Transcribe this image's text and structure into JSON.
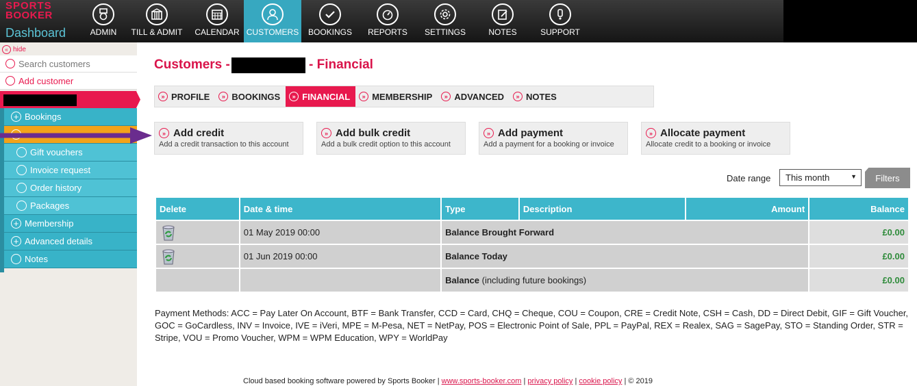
{
  "brand": {
    "line1": "SPORTS",
    "line2": "BOOKER",
    "line3": "Dashboard"
  },
  "nav": [
    {
      "label": "ADMIN",
      "icon": "admin-medal-icon"
    },
    {
      "label": "TILL & ADMIT",
      "icon": "till-gate-icon"
    },
    {
      "label": "CALENDAR",
      "icon": "calendar-icon"
    },
    {
      "label": "CUSTOMERS",
      "icon": "user-icon",
      "active": true
    },
    {
      "label": "BOOKINGS",
      "icon": "check-icon"
    },
    {
      "label": "REPORTS",
      "icon": "gauge-icon"
    },
    {
      "label": "SETTINGS",
      "icon": "gear-icon"
    },
    {
      "label": "NOTES",
      "icon": "edit-note-icon"
    },
    {
      "label": "SUPPORT",
      "icon": "exclamation-icon"
    }
  ],
  "sidebar": {
    "hide": "hide",
    "search": "Search customers",
    "add": "Add customer",
    "items": [
      {
        "label": "Bookings",
        "type": "top",
        "icon": "plus"
      },
      {
        "label": "",
        "type": "top",
        "icon": "minus"
      },
      {
        "label": "Gift vouchers",
        "type": "sub"
      },
      {
        "label": "Invoice request",
        "type": "sub"
      },
      {
        "label": "Order history",
        "type": "sub"
      },
      {
        "label": "Packages",
        "type": "sub"
      },
      {
        "label": "Membership",
        "type": "top",
        "icon": "plus"
      },
      {
        "label": "Advanced details",
        "type": "top",
        "icon": "plus"
      },
      {
        "label": "Notes",
        "type": "top",
        "icon": "circle"
      }
    ]
  },
  "page": {
    "title_prefix": "Customers -",
    "title_suffix": "- Financial"
  },
  "tabs": [
    {
      "label": "PROFILE"
    },
    {
      "label": "BOOKINGS"
    },
    {
      "label": "FINANCIAL",
      "active": true
    },
    {
      "label": "MEMBERSHIP"
    },
    {
      "label": "ADVANCED"
    },
    {
      "label": "NOTES"
    }
  ],
  "actions": [
    {
      "title": "Add credit",
      "desc": "Add a credit transaction to this account"
    },
    {
      "title": "Add bulk credit",
      "desc": "Add a bulk credit option to this account"
    },
    {
      "title": "Add payment",
      "desc": "Add a payment for a booking or invoice"
    },
    {
      "title": "Allocate payment",
      "desc": "Allocate credit to a booking or invoice"
    }
  ],
  "filters": {
    "date_range_label": "Date range",
    "date_range_value": "This month",
    "filters_button": "Filters"
  },
  "table": {
    "headers": [
      "Delete",
      "Date & time",
      "Type",
      "Description",
      "Amount",
      "Balance"
    ],
    "rows": [
      {
        "datetime": "01 May 2019 00:00",
        "type": "Balance Brought Forward",
        "balance": "£0.00"
      },
      {
        "datetime": "01 Jun 2019 00:00",
        "type": "Balance Today",
        "balance": "£0.00"
      }
    ],
    "final": {
      "type_bold": "Balance",
      "type_rest": " (including future bookings)",
      "balance": "£0.00"
    }
  },
  "payment_methods": "Payment Methods: ACC = Pay Later On Account, BTF = Bank Transfer, CCD = Card, CHQ = Cheque, COU = Coupon, CRE = Credit Note, CSH = Cash, DD = Direct Debit, GIF = Gift Voucher, GOC = GoCardless, INV = Invoice, IVE = iVeri, MPE = M-Pesa, NET = NetPay, POS = Electronic Point of Sale, PPL = PayPal, REX = Realex, SAG = SagePay, STO = Standing Order, STR = Stripe, VOU = Promo Voucher, WPM = WPM Education, WPY = WorldPay",
  "footer": {
    "text": "Cloud based booking software powered by Sports Booker",
    "link1": "www.sports-booker.com",
    "link2": "privacy policy",
    "link3": "cookie policy",
    "copy": "© 2019"
  },
  "colors": {
    "brand_red": "#e8194e",
    "teal": "#3db6cb",
    "balance_green": "#2e8b3a",
    "annotation_purple": "#6a2c8e"
  }
}
